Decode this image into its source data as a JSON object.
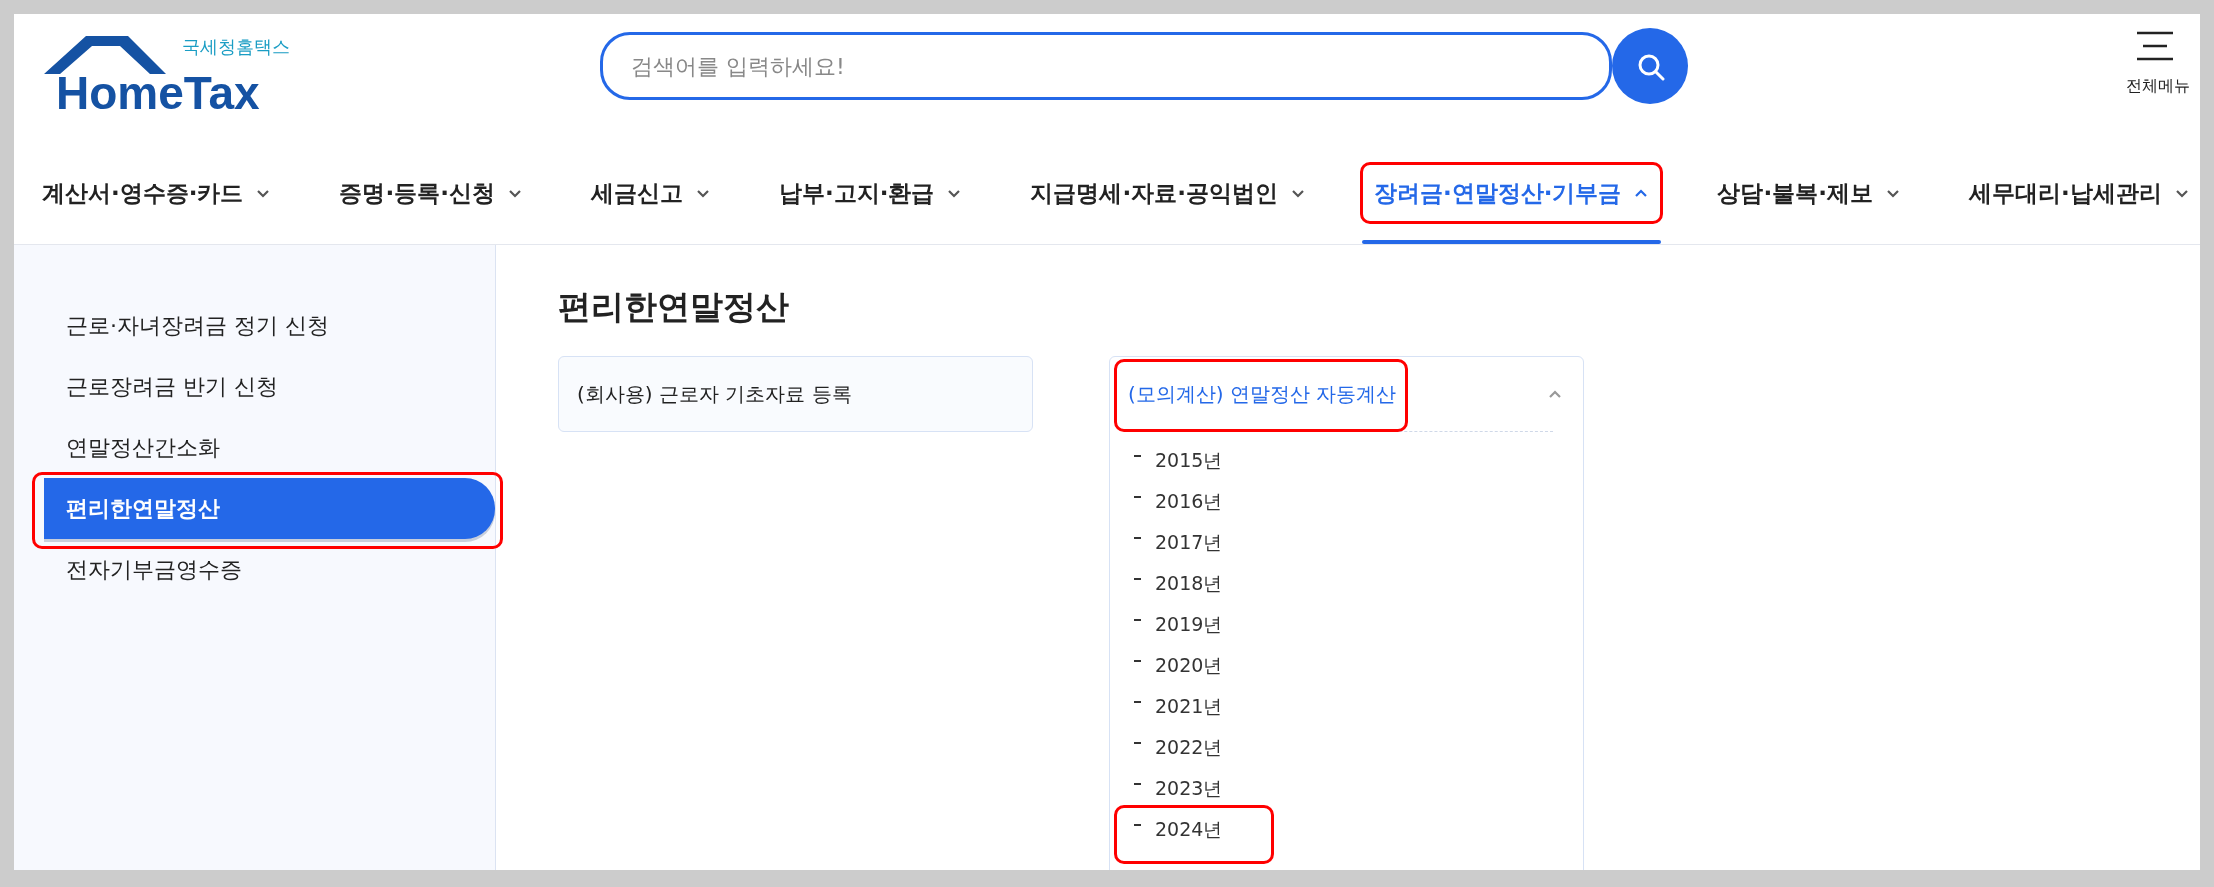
{
  "logo": {
    "subtitle": "국세청홈택스",
    "title": "HomeTax"
  },
  "search": {
    "placeholder": "검색어를 입력하세요!"
  },
  "all_menu": {
    "label": "전체메뉴"
  },
  "nav": [
    {
      "label": "계산서·영수증·카드",
      "selected": false,
      "highlighted": false
    },
    {
      "label": "증명·등록·신청",
      "selected": false,
      "highlighted": false
    },
    {
      "label": "세금신고",
      "selected": false,
      "highlighted": false
    },
    {
      "label": "납부·고지·환급",
      "selected": false,
      "highlighted": false
    },
    {
      "label": "지급명세·자료·공익법인",
      "selected": false,
      "highlighted": false
    },
    {
      "label": "장려금·연말정산·기부금",
      "selected": true,
      "highlighted": true
    },
    {
      "label": "상담·불복·제보",
      "selected": false,
      "highlighted": false
    },
    {
      "label": "세무대리·납세관리",
      "selected": false,
      "highlighted": false
    }
  ],
  "sidebar": {
    "items": [
      {
        "label": "근로·자녀장려금 정기 신청",
        "selected": false,
        "highlighted": false
      },
      {
        "label": "근로장려금 반기 신청",
        "selected": false,
        "highlighted": false
      },
      {
        "label": "연말정산간소화",
        "selected": false,
        "highlighted": false
      },
      {
        "label": "편리한연말정산",
        "selected": true,
        "highlighted": true
      },
      {
        "label": "전자기부금영수증",
        "selected": false,
        "highlighted": false
      }
    ]
  },
  "content": {
    "title": "편리한연말정산",
    "cards": [
      {
        "label": "(회사용) 근로자 기초자료 등록",
        "expanded": false,
        "highlighted": false
      },
      {
        "label": "(모의계산) 연말정산 자동계산",
        "expanded": true,
        "highlighted": true,
        "items": [
          {
            "label": "2015년",
            "highlighted": false
          },
          {
            "label": "2016년",
            "highlighted": false
          },
          {
            "label": "2017년",
            "highlighted": false
          },
          {
            "label": "2018년",
            "highlighted": false
          },
          {
            "label": "2019년",
            "highlighted": false
          },
          {
            "label": "2020년",
            "highlighted": false
          },
          {
            "label": "2021년",
            "highlighted": false
          },
          {
            "label": "2022년",
            "highlighted": false
          },
          {
            "label": "2023년",
            "highlighted": false
          },
          {
            "label": "2024년",
            "highlighted": true
          }
        ]
      }
    ]
  }
}
